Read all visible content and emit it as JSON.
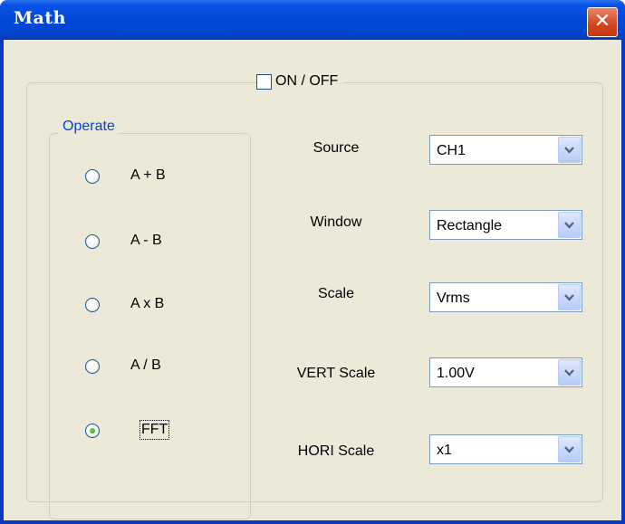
{
  "window": {
    "title": "Math"
  },
  "onoff": {
    "label": "ON / OFF",
    "checked": false
  },
  "operate": {
    "legend": "Operate",
    "options": [
      "A + B",
      "A - B",
      "A x B",
      "A / B",
      "FFT"
    ],
    "selected": "FFT"
  },
  "fields": [
    {
      "label": "Source",
      "value": "CH1"
    },
    {
      "label": "Window",
      "value": "Rectangle"
    },
    {
      "label": "Scale",
      "value": "Vrms"
    },
    {
      "label": "VERT Scale",
      "value": "1.00V"
    },
    {
      "label": "HORI Scale",
      "value": "x1"
    }
  ],
  "icons": {
    "close": "close-icon",
    "dropdown": "chevron-down-icon"
  },
  "colors": {
    "titlebar": "#0248d8",
    "client": "#ece9d8",
    "legend": "#0046d5",
    "close": "#d4441c",
    "radio_checked": "#21a121"
  }
}
